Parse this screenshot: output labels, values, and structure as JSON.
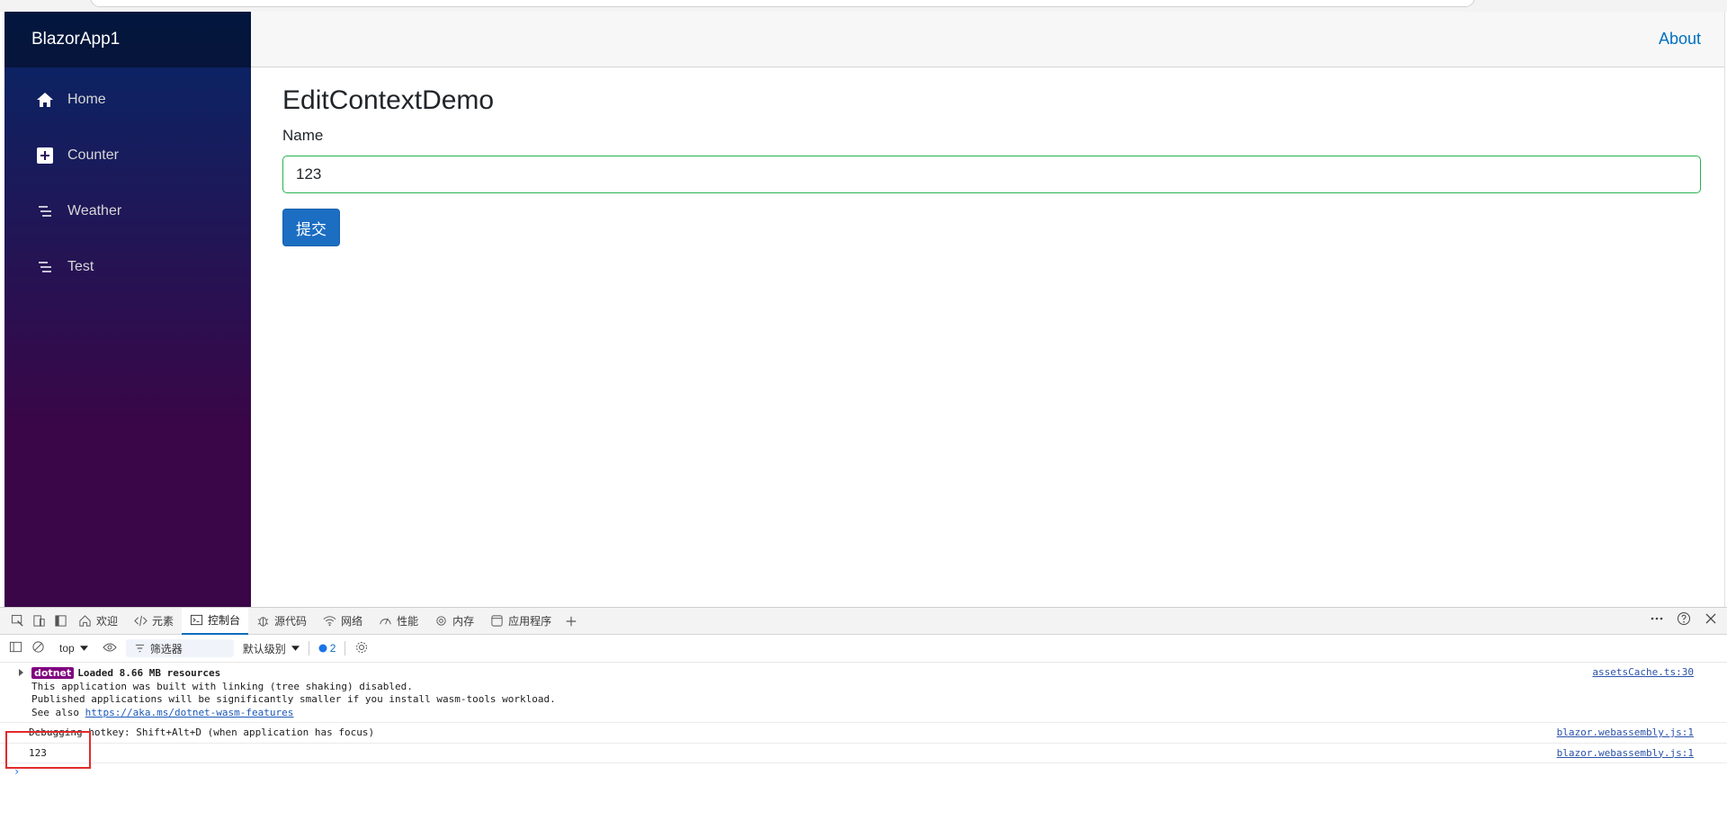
{
  "app": {
    "brand": "BlazorApp1",
    "top_link": "About",
    "nav": [
      {
        "label": "Home",
        "icon": "home-icon"
      },
      {
        "label": "Counter",
        "icon": "plus-square-icon"
      },
      {
        "label": "Weather",
        "icon": "list-icon"
      },
      {
        "label": "Test",
        "icon": "list-icon"
      }
    ],
    "page_title": "EditContextDemo",
    "name_label": "Name",
    "name_value": "123",
    "submit_label": "提交"
  },
  "devtools": {
    "tabs": [
      {
        "label": "欢迎",
        "icon": "home-icon"
      },
      {
        "label": "元素",
        "icon": "code-icon"
      },
      {
        "label": "控制台",
        "icon": "console-icon",
        "active": true
      },
      {
        "label": "源代码",
        "icon": "bug-icon"
      },
      {
        "label": "网络",
        "icon": "wifi-icon"
      },
      {
        "label": "性能",
        "icon": "gauge-icon"
      },
      {
        "label": "内存",
        "icon": "chip-icon"
      },
      {
        "label": "应用程序",
        "icon": "app-icon"
      }
    ],
    "context": "top",
    "filter_placeholder": "筛选器",
    "level": "默认级别",
    "issues_count": "2",
    "messages": {
      "m1_badge": "dotnet",
      "m1_line1": "Loaded 8.66 MB resources",
      "m1_line2": "This application was built with linking (tree shaking) disabled.",
      "m1_line3": "Published applications will be significantly smaller if you install wasm-tools workload.",
      "m1_line4_prefix": "See also ",
      "m1_link": "https://aka.ms/dotnet-wasm-features",
      "m1_source": "assetsCache.ts:30",
      "m2_text": "Debugging hotkey: Shift+Alt+D (when application has focus)",
      "m2_source": "blazor.webassembly.js:1",
      "m3_text": "123",
      "m3_source": "blazor.webassembly.js:1"
    }
  },
  "colors": {
    "sidebar_top": "#052767",
    "sidebar_bottom": "#3a0647",
    "button": "#1b6ec2",
    "link": "#0071c1",
    "highlight": "#e12b2b"
  }
}
